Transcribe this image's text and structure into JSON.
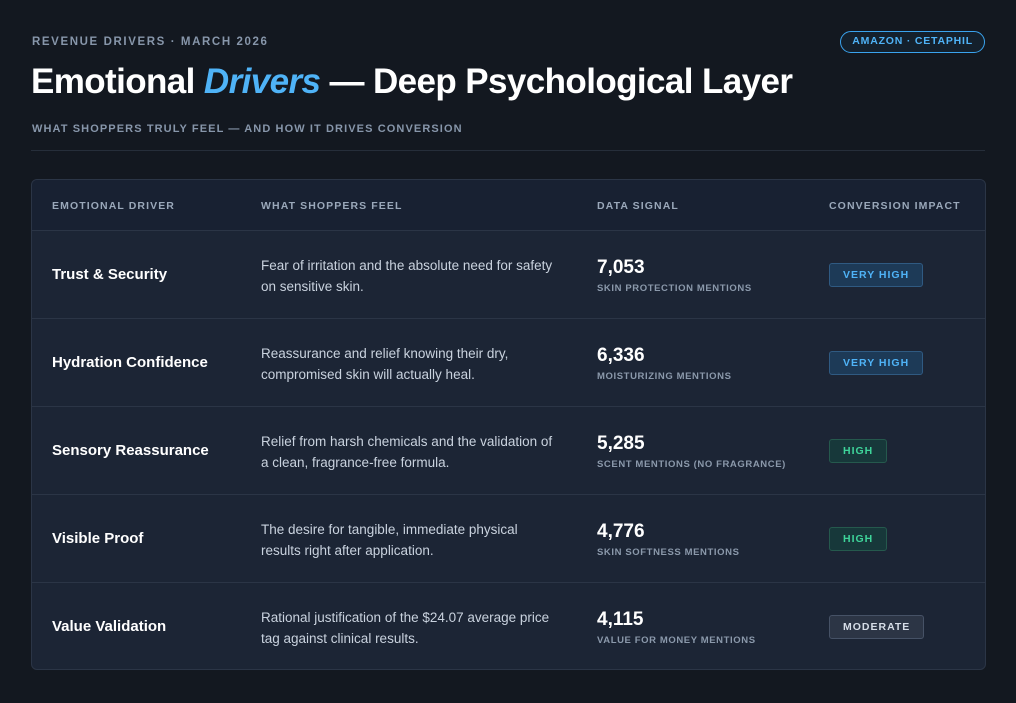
{
  "header": {
    "eyebrow": "REVENUE DRIVERS · MARCH 2026",
    "pill": "AMAZON · CETAPHIL",
    "title_pre": "Emotional ",
    "title_accent": "Drivers",
    "title_post": " — Deep Psychological Layer",
    "subtitle": "WHAT SHOPPERS TRULY FEEL — AND HOW IT DRIVES CONVERSION"
  },
  "table": {
    "columns": [
      "EMOTIONAL DRIVER",
      "WHAT SHOPPERS FEEL",
      "DATA SIGNAL",
      "CONVERSION IMPACT"
    ],
    "rows": [
      {
        "driver": "Trust & Security",
        "feel": "Fear of irritation and the absolute need for safety on sensitive skin.",
        "signal_value": "7,053",
        "signal_label": "SKIN PROTECTION MENTIONS",
        "impact": "VERY HIGH",
        "impact_level": "vhigh"
      },
      {
        "driver": "Hydration Confidence",
        "feel": "Reassurance and relief knowing their dry, compromised skin will actually heal.",
        "signal_value": "6,336",
        "signal_label": "MOISTURIZING MENTIONS",
        "impact": "VERY HIGH",
        "impact_level": "vhigh"
      },
      {
        "driver": "Sensory Reassurance",
        "feel": "Relief from harsh chemicals and the validation of a clean, fragrance-free formula.",
        "signal_value": "5,285",
        "signal_label": "SCENT MENTIONS (NO FRAGRANCE)",
        "impact": "HIGH",
        "impact_level": "high"
      },
      {
        "driver": "Visible Proof",
        "feel": "The desire for tangible, immediate physical results right after application.",
        "signal_value": "4,776",
        "signal_label": "SKIN SOFTNESS MENTIONS",
        "impact": "HIGH",
        "impact_level": "high"
      },
      {
        "driver": "Value Validation",
        "feel": "Rational justification of the $24.07 average price tag against clinical results.",
        "signal_value": "4,115",
        "signal_label": "VALUE FOR MONEY MENTIONS",
        "impact": "MODERATE",
        "impact_level": "mod"
      }
    ]
  },
  "colors": {
    "background": "#131820",
    "card": "#1c2535",
    "accent": "#4fb3f7",
    "very_high": "#4fb3f7",
    "high": "#3ed49a",
    "moderate": "#d6dde7"
  }
}
